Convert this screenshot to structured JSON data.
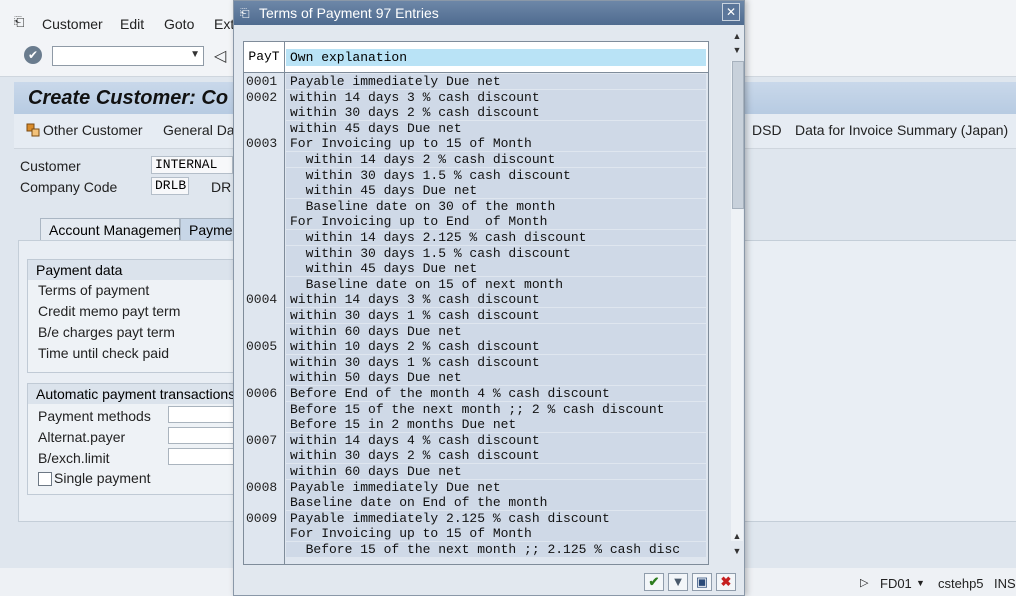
{
  "window": {
    "menu": [
      "Customer",
      "Edit",
      "Goto",
      "Extr"
    ],
    "page_title": "Create Customer: Co",
    "toolbar_buttons": [
      "Other Customer",
      "General Data",
      "DSD",
      "Data for Invoice Summary (Japan)"
    ]
  },
  "header_fields": {
    "customer_label": "Customer",
    "customer_value": "INTERNAL",
    "company_code_label": "Company Code",
    "company_code_value": "DRLB",
    "company_code_text": "DR"
  },
  "tabs": [
    "Account Management",
    "Payme"
  ],
  "payment_group": {
    "title": "Payment data",
    "rows": [
      "Terms of payment",
      "Credit memo payt term",
      "B/e charges payt term",
      "Time until check paid"
    ]
  },
  "auto_group": {
    "title": "Automatic payment transactions",
    "rows": [
      "Payment methods",
      "Alternat.payer",
      "B/exch.limit"
    ],
    "single_payment": "Single payment"
  },
  "status_bar": {
    "transaction": "FD01",
    "server": "cstehp5",
    "mode": "INS"
  },
  "dialog": {
    "title": "Terms of Payment 97 Entries",
    "column_payt": "PayT",
    "column_expl": "Own explanation",
    "rows": [
      {
        "payt": "0001",
        "expl": "Payable immediately Due net"
      },
      {
        "payt": "0002",
        "expl": "within 14 days 3 % cash discount"
      },
      {
        "payt": "",
        "expl": "within 30 days 2 % cash discount"
      },
      {
        "payt": "",
        "expl": "within 45 days Due net"
      },
      {
        "payt": "0003",
        "expl": "For Invoicing up to 15 of Month"
      },
      {
        "payt": "",
        "expl": "  within 14 days 2 % cash discount"
      },
      {
        "payt": "",
        "expl": "  within 30 days 1.5 % cash discount"
      },
      {
        "payt": "",
        "expl": "  within 45 days Due net"
      },
      {
        "payt": "",
        "expl": "  Baseline date on 30 of the month"
      },
      {
        "payt": "",
        "expl": "For Invoicing up to End  of Month"
      },
      {
        "payt": "",
        "expl": "  within 14 days 2.125 % cash discount"
      },
      {
        "payt": "",
        "expl": "  within 30 days 1.5 % cash discount"
      },
      {
        "payt": "",
        "expl": "  within 45 days Due net"
      },
      {
        "payt": "",
        "expl": "  Baseline date on 15 of next month"
      },
      {
        "payt": "0004",
        "expl": "within 14 days 3 % cash discount"
      },
      {
        "payt": "",
        "expl": "within 30 days 1 % cash discount"
      },
      {
        "payt": "",
        "expl": "within 60 days Due net"
      },
      {
        "payt": "0005",
        "expl": "within 10 days 2 % cash discount"
      },
      {
        "payt": "",
        "expl": "within 30 days 1 % cash discount"
      },
      {
        "payt": "",
        "expl": "within 50 days Due net"
      },
      {
        "payt": "0006",
        "expl": "Before End of the month 4 % cash discount"
      },
      {
        "payt": "",
        "expl": "Before 15 of the next month ;; 2 % cash discount"
      },
      {
        "payt": "",
        "expl": "Before 15 in 2 months Due net"
      },
      {
        "payt": "0007",
        "expl": "within 14 days 4 % cash discount"
      },
      {
        "payt": "",
        "expl": "within 30 days 2 % cash discount"
      },
      {
        "payt": "",
        "expl": "within 60 days Due net"
      },
      {
        "payt": "0008",
        "expl": "Payable immediately Due net"
      },
      {
        "payt": "",
        "expl": "Baseline date on End of the month"
      },
      {
        "payt": "0009",
        "expl": "Payable immediately 2.125 % cash discount"
      },
      {
        "payt": "",
        "expl": "For Invoicing up to 15 of Month"
      },
      {
        "payt": "",
        "expl": "  Before 15 of the next month ;; 2.125 % cash disc"
      }
    ]
  }
}
